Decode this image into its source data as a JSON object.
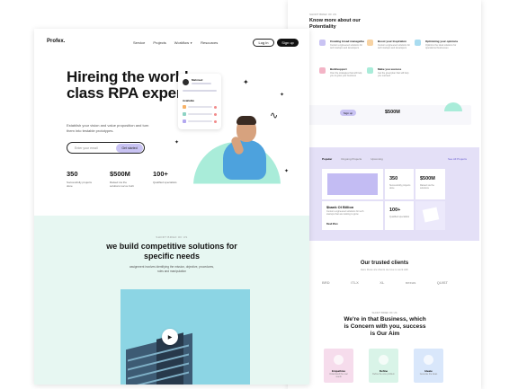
{
  "left": {
    "logo": "Profex.",
    "nav": [
      {
        "label": "Service"
      },
      {
        "label": "Projects"
      },
      {
        "label": "Workflow"
      },
      {
        "label": "Resources"
      }
    ],
    "login_label": "Log in",
    "signup_label": "Sign up",
    "hero": {
      "title": "Hireing the world class RPA experts",
      "subtitle": "Establish your vision and value proposition and turn them into testable prototypes.",
      "email_placeholder": "Enter your email",
      "cta_label": "Get started"
    },
    "stats": [
      {
        "value": "350",
        "label": "Successfully projects done"
      },
      {
        "value": "$500M",
        "label": "Raised via the solutions we've built"
      },
      {
        "value": "100+",
        "label": "Qualified specialists"
      }
    ],
    "profile_card": {
      "name": "Mahmud",
      "label": "Available"
    },
    "section2": {
      "kicker": "SHORT BRIEF OF US",
      "title": "we build competitive solutions for specific needs",
      "description": "assignment involves identifying the mission, objective, procedures, rules and manipulation"
    }
  },
  "right": {
    "kicker": "SHORT BRIEF OF US",
    "title": "Know more about our Potentiality",
    "features": [
      {
        "name": "Creating broad managethe",
        "desc": "Custom engineered solutions for tech startups and developers",
        "color": "#c9c3f3"
      },
      {
        "name": "Boost your Inspiration",
        "desc": "Custom engineered solutions for tech startups and developers",
        "color": "#f7d3a4"
      },
      {
        "name": "Optimizing your opinions",
        "desc": "Optimize the ideal solutions for operational businesses",
        "color": "#a9dcf0"
      },
      {
        "name": "Buildsupport",
        "desc": "Own the strategies that will help you to grow your business",
        "color": "#f3b4c6"
      },
      {
        "name": "Make you success",
        "desc": "Get the great plan that will help you succeed",
        "color": "#a9ecd9"
      }
    ],
    "banner": {
      "pill": "Sign up",
      "value": "$500M"
    },
    "projects": {
      "tabs": [
        "Popular",
        "Ongoing Projects",
        "Upcoming"
      ],
      "all_link": "See All Projects",
      "stat1_value": "350",
      "stat1_label": "Successfully projects done",
      "stat2_value": "$500M",
      "stat2_label": "Raised via the solutions",
      "feature_title": "$bank OI Billion",
      "feature_desc": "Custom engineered solutions for tech startups that are looking to grow",
      "feature_link": "Read More",
      "stat3_value": "100+",
      "stat3_label": "Qualified specialists"
    },
    "clients": {
      "title": "Our trusted clients",
      "subtitle": "Here these are clients we love to work with",
      "logos": [
        "BRD",
        "iTLX",
        "XL",
        "nexus",
        "QUIST"
      ]
    },
    "aim": {
      "kicker": "SHORT BRIEF OF US",
      "title": "We're in that Business, which is Concern with you, success is Our Aim",
      "cards": [
        {
          "name": "Empathize",
          "desc": "Understand the user needs",
          "color": "#f6dcec"
        },
        {
          "name": "Define",
          "desc": "Define the core problem",
          "color": "#d9f4e8"
        },
        {
          "name": "Ideate",
          "desc": "Generate the ideas",
          "color": "#d9e7fb"
        }
      ]
    }
  }
}
